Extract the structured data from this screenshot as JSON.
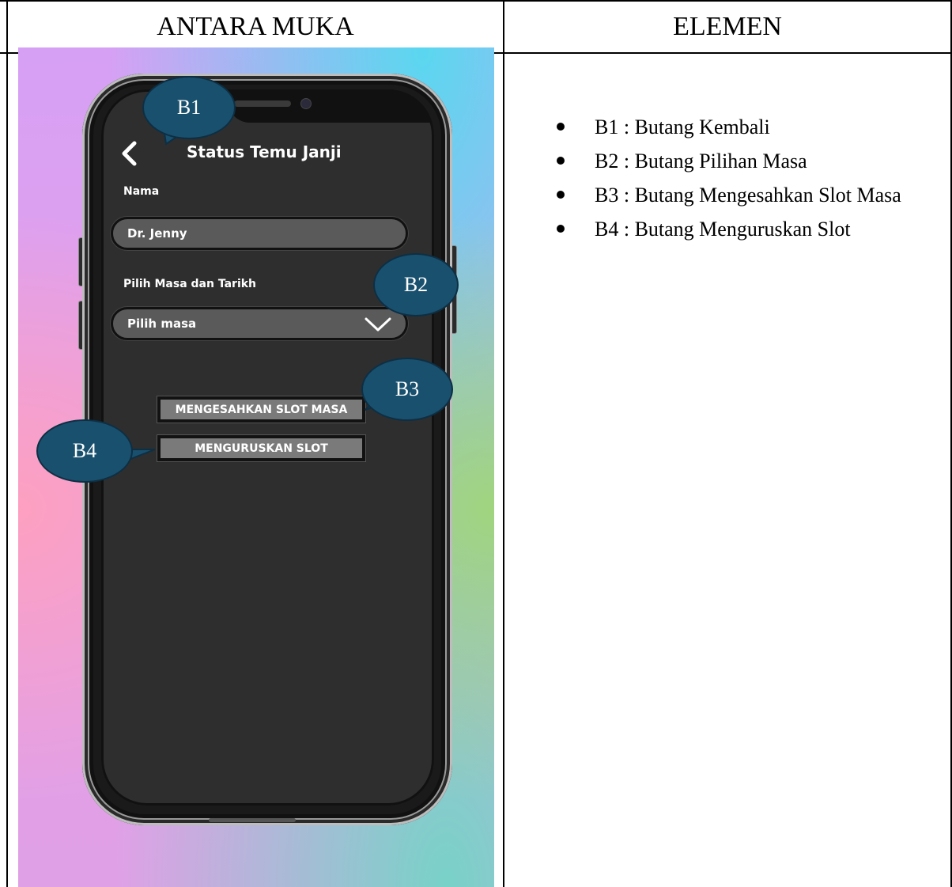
{
  "table": {
    "header_left": "ANTARA MUKA",
    "header_right": "ELEMEN"
  },
  "phone_screen": {
    "title": "Status Temu Janji",
    "back_icon": "chevron-left-icon",
    "name_label": "Nama",
    "name_value": "Dr. Jenny",
    "time_label": "Pilih Masa dan Tarikh",
    "time_placeholder": "Pilih masa",
    "dropdown_icon": "chevron-down-icon",
    "confirm_button": "MENGESAHKAN SLOT MASA",
    "manage_button": "MENGURUSKAN SLOT"
  },
  "callouts": {
    "b1": "B1",
    "b2": "B2",
    "b3": "B3",
    "b4": "B4",
    "color": "#19506e"
  },
  "elements": [
    "B1 : Butang Kembali",
    "B2 : Butang Pilihan Masa",
    "B3 : Butang Mengesahkan Slot Masa",
    "B4 : Butang Menguruskan Slot"
  ]
}
